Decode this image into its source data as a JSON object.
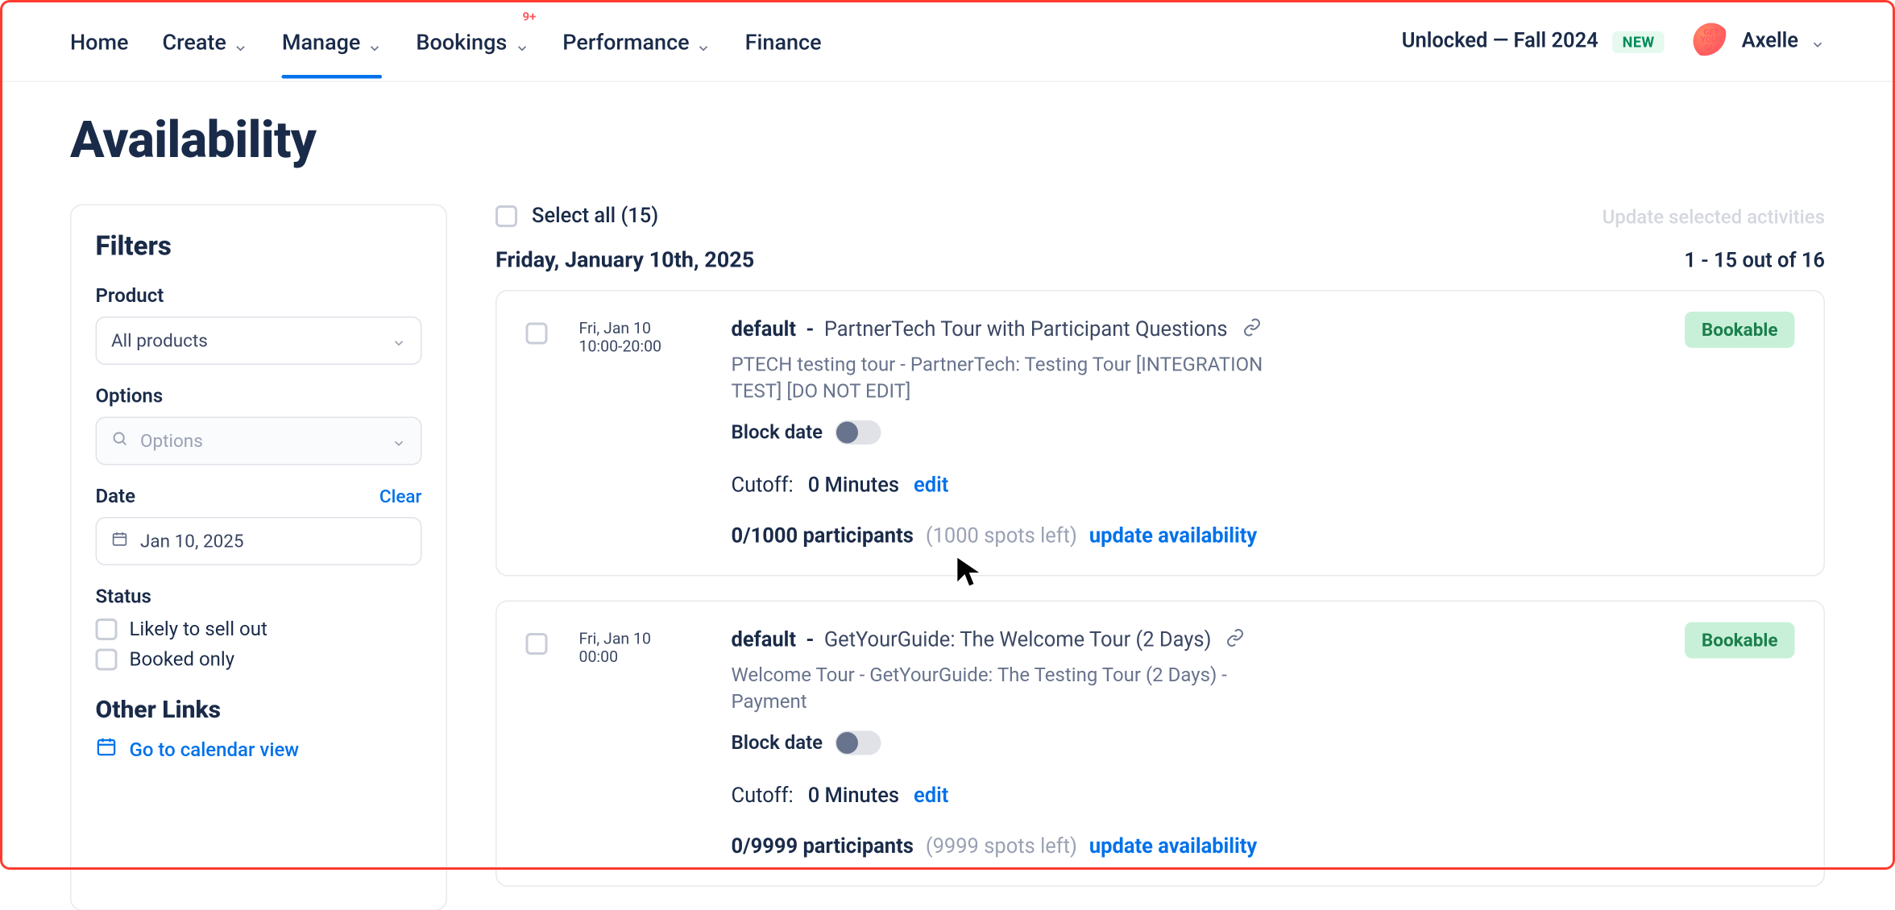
{
  "nav": {
    "home": "Home",
    "create": "Create",
    "manage": "Manage",
    "bookings": "Bookings",
    "bookings_badge": "9+",
    "performance": "Performance",
    "finance": "Finance",
    "unlocked": "Unlocked — Fall 2024",
    "new": "NEW",
    "username": "Axelle",
    "avatar_text": "GET YOUR GUI"
  },
  "page": {
    "title": "Availability"
  },
  "filters": {
    "title": "Filters",
    "product_label": "Product",
    "product_value": "All products",
    "options_label": "Options",
    "options_placeholder": "Options",
    "date_label": "Date",
    "clear": "Clear",
    "date_value": "Jan 10, 2025",
    "status_label": "Status",
    "status_opt1": "Likely to sell out",
    "status_opt2": "Booked only",
    "other_title": "Other Links",
    "calendar_link": "Go to calendar view"
  },
  "list": {
    "select_all": "Select all (15)",
    "update_selected": "Update selected activities",
    "date_heading": "Friday, January 10th, 2025",
    "count": "1 - 15 out of 16"
  },
  "cards": [
    {
      "date": "Fri, Jan 10",
      "time": "10:00-20:00",
      "default": "default",
      "sep": " - ",
      "name": "PartnerTech Tour with Participant Questions",
      "subtitle": "PTECH testing tour - PartnerTech: Testing Tour [INTEGRATION TEST] [DO NOT EDIT]",
      "block_label": "Block date",
      "cutoff_label": "Cutoff:",
      "cutoff_value": "0 Minutes",
      "edit": "edit",
      "participants_bold": "0/1000 participants",
      "participants_muted": "(1000 spots left)",
      "update": "update availability",
      "status": "Bookable"
    },
    {
      "date": "Fri, Jan 10",
      "time": "00:00",
      "default": "default",
      "sep": " - ",
      "name": "GetYourGuide: The Welcome Tour (2 Days)",
      "subtitle": "Welcome Tour - GetYourGuide: The Testing Tour (2 Days) - Payment",
      "block_label": "Block date",
      "cutoff_label": "Cutoff:",
      "cutoff_value": "0 Minutes",
      "edit": "edit",
      "participants_bold": "0/9999 participants",
      "participants_muted": "(9999 spots left)",
      "update": "update availability",
      "status": "Bookable"
    }
  ]
}
